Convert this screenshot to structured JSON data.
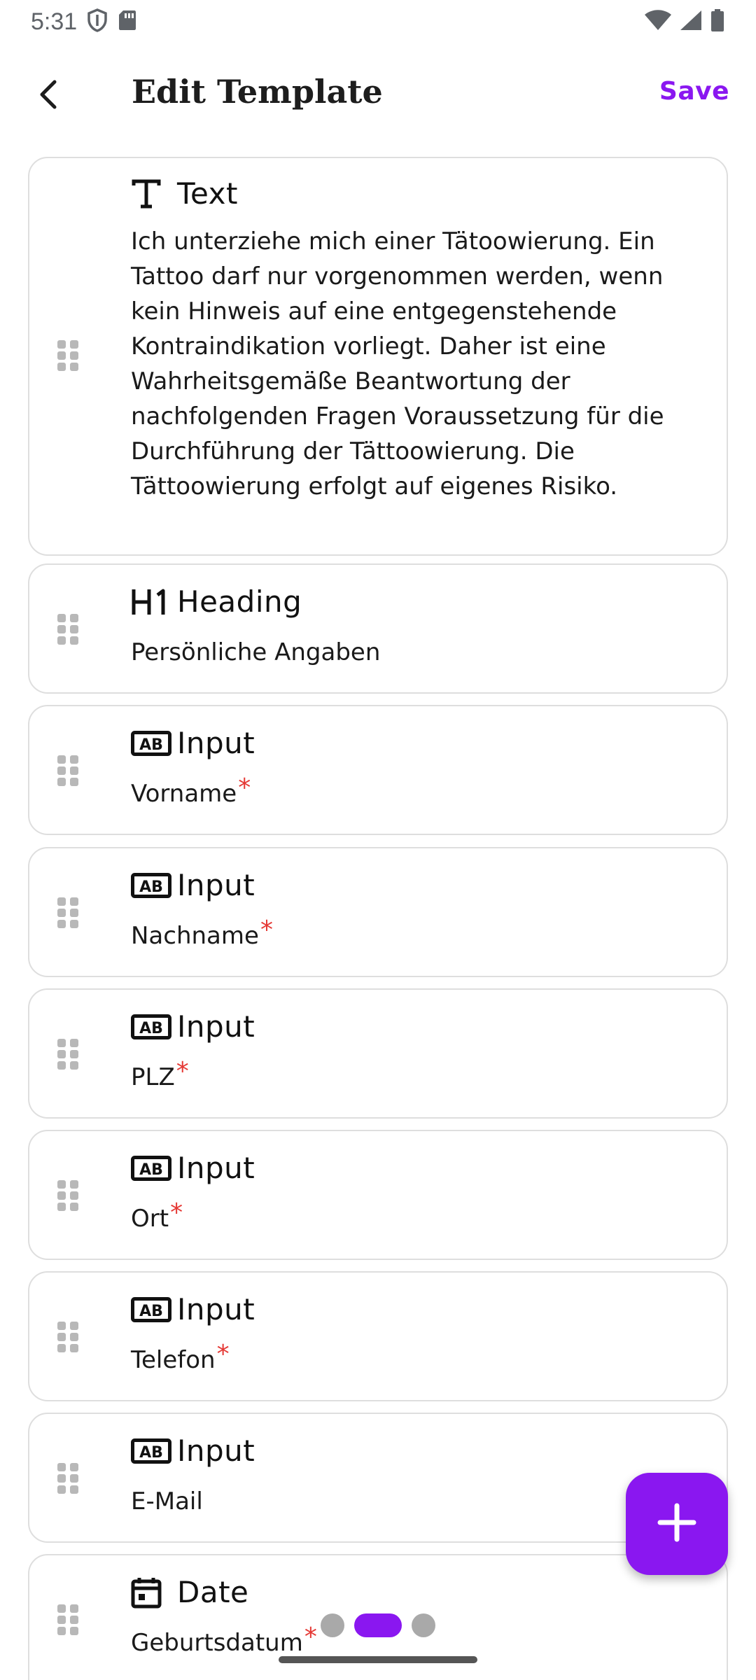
{
  "status_bar": {
    "time": "5:31",
    "icons": [
      "shield-icon",
      "sd-card-icon",
      "wifi-icon",
      "cell-signal-icon",
      "battery-icon"
    ]
  },
  "header": {
    "title": "Edit Template",
    "save_label": "Save",
    "back_icon": "chevron-left-icon"
  },
  "colors": {
    "accent": "#8a17f0",
    "required": "#e53935",
    "border": "#dedede"
  },
  "fields": [
    {
      "type": "Text",
      "icon": "text-icon",
      "content": "Ich unterziehe mich einer Tätoowierung. Ein Tattoo darf nur vorgenommen werden, wenn kein Hinweis auf eine entgegenstehende Kontraindikation vorliegt. Daher ist eine Wahrheitsgemäße Beantwortung der nachfolgenden Fragen Voraussetzung für die Durchführung der Tättoowierung. Die Tättoowierung erfolgt auf eigenes Risiko.",
      "required": false
    },
    {
      "type": "Heading",
      "icon": "heading-h1-icon",
      "content": "Persönliche Angaben",
      "required": false
    },
    {
      "type": "Input",
      "icon": "input-ab-icon",
      "content": "Vorname",
      "required": true
    },
    {
      "type": "Input",
      "icon": "input-ab-icon",
      "content": "Nachname",
      "required": true
    },
    {
      "type": "Input",
      "icon": "input-ab-icon",
      "content": "PLZ",
      "required": true
    },
    {
      "type": "Input",
      "icon": "input-ab-icon",
      "content": "Ort",
      "required": true
    },
    {
      "type": "Input",
      "icon": "input-ab-icon",
      "content": "Telefon",
      "required": true
    },
    {
      "type": "Input",
      "icon": "input-ab-icon",
      "content": "E-Mail",
      "required": false
    },
    {
      "type": "Date",
      "icon": "calendar-icon",
      "content": "Geburtsdatum",
      "required": true
    }
  ],
  "required_mark": "*",
  "fab": {
    "icon": "plus-icon"
  },
  "pager": {
    "count": 3,
    "active": 1
  }
}
